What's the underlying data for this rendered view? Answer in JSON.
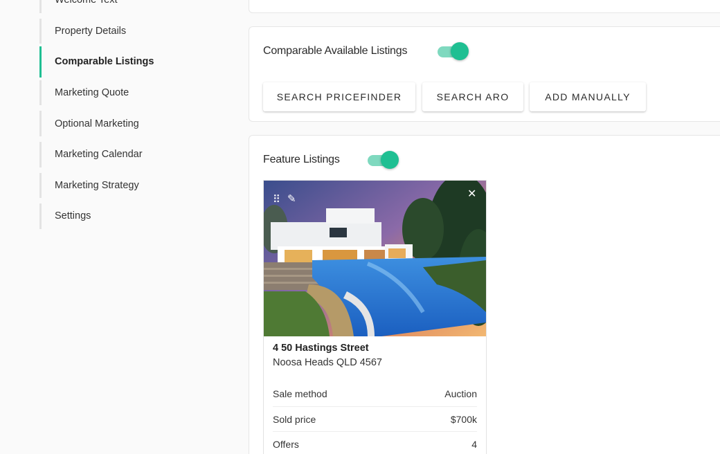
{
  "sidebar": {
    "items": [
      {
        "label": "Welcome Text"
      },
      {
        "label": "Property Details"
      },
      {
        "label": "Comparable Listings"
      },
      {
        "label": "Marketing Quote"
      },
      {
        "label": "Optional Marketing"
      },
      {
        "label": "Marketing Calendar"
      },
      {
        "label": "Marketing Strategy"
      },
      {
        "label": "Settings"
      }
    ],
    "active": "Comparable Listings"
  },
  "comparable": {
    "title": "Comparable Available Listings",
    "toggle_on": true,
    "buttons": {
      "pricefinder": "SEARCH PRICEFINDER",
      "aro": "SEARCH ARO",
      "manual": "ADD MANUALLY"
    }
  },
  "feature": {
    "title": "Feature Listings",
    "toggle_on": true,
    "listing": {
      "address_line1": "4 50 Hastings Street",
      "address_line2": "Noosa Heads QLD 4567",
      "details": [
        {
          "label": "Sale method",
          "value": "Auction"
        },
        {
          "label": "Sold price",
          "value": "$700k"
        },
        {
          "label": "Offers",
          "value": "4"
        }
      ]
    }
  },
  "colors": {
    "accent": "#1fbf92",
    "accent_light": "#7fd9bf"
  },
  "icons": [
    "drag-handle-icon",
    "pencil-icon",
    "close-icon"
  ]
}
